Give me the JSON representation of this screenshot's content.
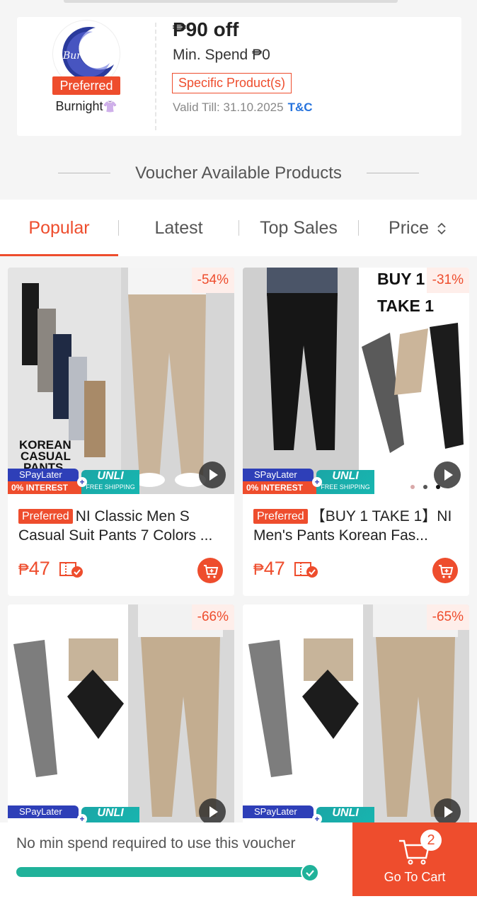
{
  "voucher": {
    "shop_badge": "Preferred",
    "shop_name": "Burnight",
    "shop_emoji": "👚",
    "logo_text": "Burnight",
    "amount": "₱90 off",
    "min_spend": "Min. Spend ₱0",
    "tag": "Specific Product(s)",
    "valid": "Valid Till: 31.10.2025",
    "tc": "T&C"
  },
  "section_title": "Voucher Available Products",
  "tabs": [
    {
      "label": "Popular",
      "active": true
    },
    {
      "label": "Latest"
    },
    {
      "label": "Top Sales"
    },
    {
      "label": "Price"
    }
  ],
  "products": [
    {
      "discount": "-54%",
      "badge": "Preferred",
      "title": "NI Classic Men S Casual Suit Pants 7 Colors ...",
      "price_currency": "₱",
      "price": "47",
      "image_text": [
        "KOREAN",
        "CASUAL",
        "PANTS"
      ],
      "spay": "SPayLater",
      "interest": "0% INTEREST",
      "unli": "UNLI",
      "free_ship": "FREE SHIPPING"
    },
    {
      "discount": "-31%",
      "badge": "Preferred",
      "title": "【BUY 1 TAKE 1】NI Men's Pants Korean Fas...",
      "price_currency": "₱",
      "price": "47",
      "image_text": [
        "BUY 1",
        "TAKE 1"
      ],
      "spay": "SPayLater",
      "interest": "0% INTEREST",
      "unli": "UNLI",
      "free_ship": "FREE SHIPPING"
    },
    {
      "discount": "-66%",
      "spay": "SPayLater",
      "unli": "UNLI"
    },
    {
      "discount": "-65%",
      "spay": "SPayLater",
      "unli": "UNLI"
    }
  ],
  "bottom_bar": {
    "message": "No min spend required to use this voucher",
    "progress": 1.0,
    "cart_label": "Go To Cart",
    "cart_count": "2"
  },
  "colors": {
    "accent": "#ee4d2d",
    "progress": "#20b29a",
    "link": "#2673dd"
  }
}
